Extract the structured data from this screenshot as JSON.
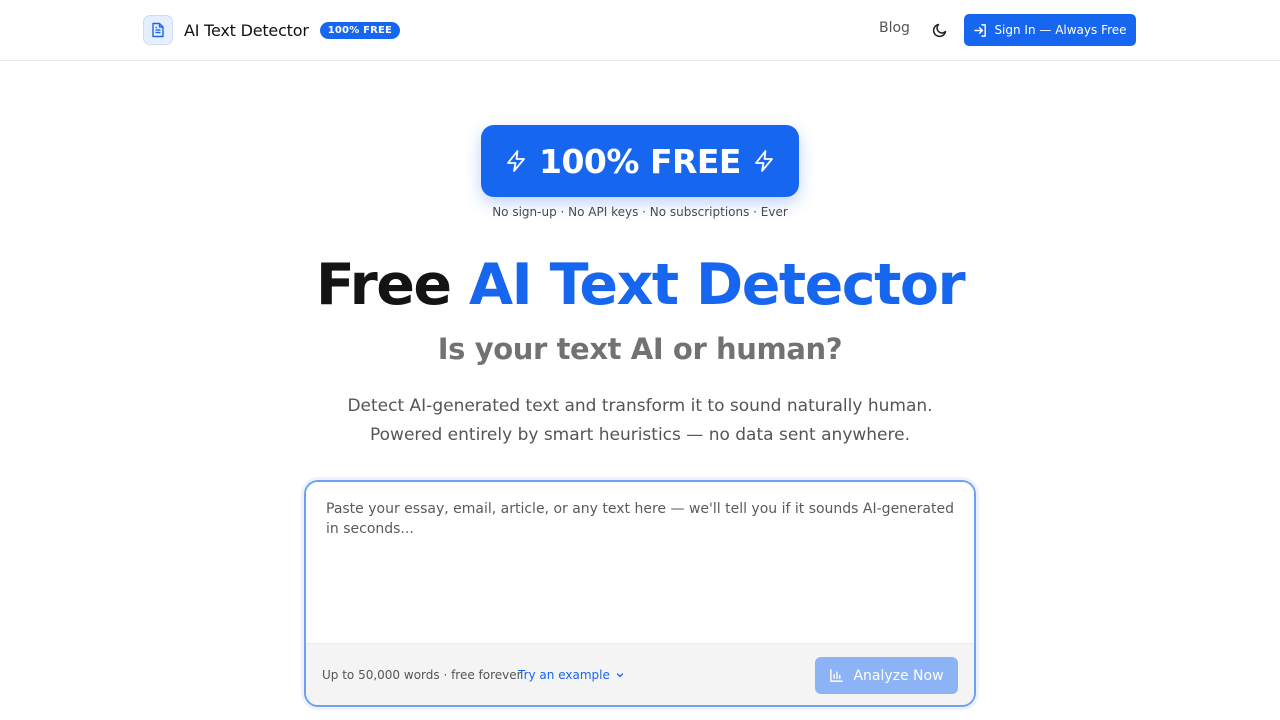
{
  "header": {
    "brand_name": "AI Text Detector",
    "brand_badge": "100% FREE",
    "nav_blog": "Blog",
    "signin_label": "Sign In — Always Free"
  },
  "hero": {
    "banner_text": "100% FREE",
    "sub_note": "No sign-up · No API keys · No subscriptions · Ever",
    "title_plain": "Free ",
    "title_accent": "AI Text Detector",
    "subtitle": "Is your text AI or human?",
    "desc_line1": "Detect AI-generated text and transform it to sound naturally human.",
    "desc_line2": "Powered entirely by smart heuristics — no data sent anywhere."
  },
  "input_card": {
    "value": "",
    "placeholder": "Paste your essay, email, article, or any text here — we'll tell you if it sounds AI-generated in seconds...",
    "word_limit": "Up to 50,000 words · free forever",
    "example_label": "Try an example",
    "analyze_label": "Analyze Now"
  },
  "icons": {
    "brand_logo": "document-icon",
    "theme": "moon-icon",
    "signin": "sign-in-icon",
    "banner": "lightning-icon",
    "example": "chevron-down-icon",
    "analyze": "bar-chart-icon"
  },
  "colors": {
    "accent": "#1766ef",
    "accent_disabled": "#8cb3f6",
    "card_border": "#6fa0f4"
  }
}
